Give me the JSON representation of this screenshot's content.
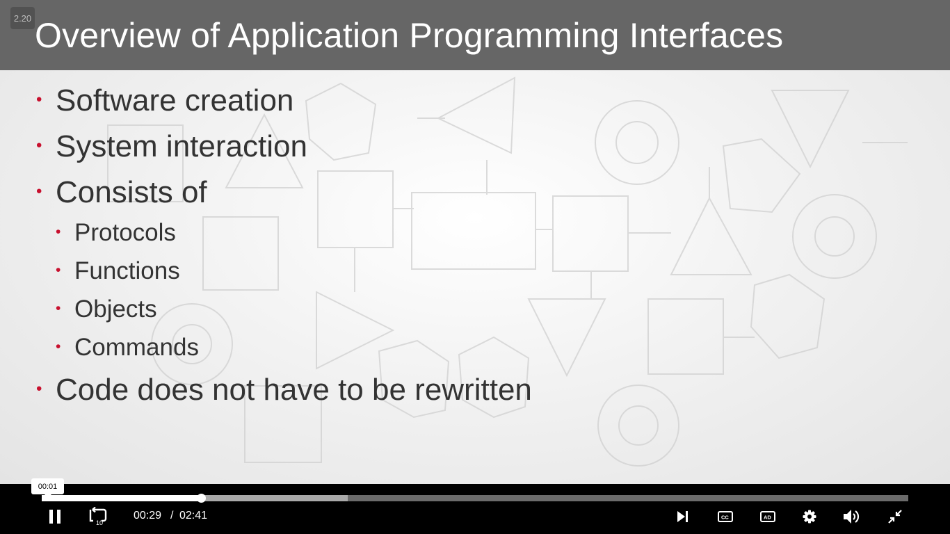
{
  "slide": {
    "version_badge": "2.20",
    "title": "Overview of Application Programming Interfaces",
    "bullets": [
      {
        "text": "Software creation",
        "level": 1
      },
      {
        "text": "System interaction",
        "level": 1
      },
      {
        "text": "Consists of",
        "level": 1
      },
      {
        "text": "Protocols",
        "level": 2
      },
      {
        "text": "Functions",
        "level": 2
      },
      {
        "text": "Objects",
        "level": 2
      },
      {
        "text": "Commands",
        "level": 2
      },
      {
        "text": "Code does not have to be rewritten",
        "level": 1
      }
    ],
    "colors": {
      "title_bar": "#666666",
      "bullet_dot": "#c8102e",
      "text": "#333333"
    }
  },
  "player": {
    "progress": {
      "played_fraction": 0.184,
      "buffered_fraction": 0.353,
      "hover_time": "00:01"
    },
    "current_time": "00:29",
    "separator": "/",
    "duration": "02:41",
    "controls": [
      {
        "name": "pause-button",
        "icon": "pause-icon"
      },
      {
        "name": "rewind-10-button",
        "icon": "replay-10-icon"
      },
      {
        "name": "next-button",
        "icon": "skip-next-icon"
      },
      {
        "name": "captions-button",
        "icon": "cc-icon"
      },
      {
        "name": "audio-description-button",
        "icon": "ad-icon"
      },
      {
        "name": "settings-button",
        "icon": "gear-icon"
      },
      {
        "name": "volume-button",
        "icon": "volume-icon"
      },
      {
        "name": "exit-fullscreen-button",
        "icon": "exit-fullscreen-icon"
      }
    ]
  }
}
